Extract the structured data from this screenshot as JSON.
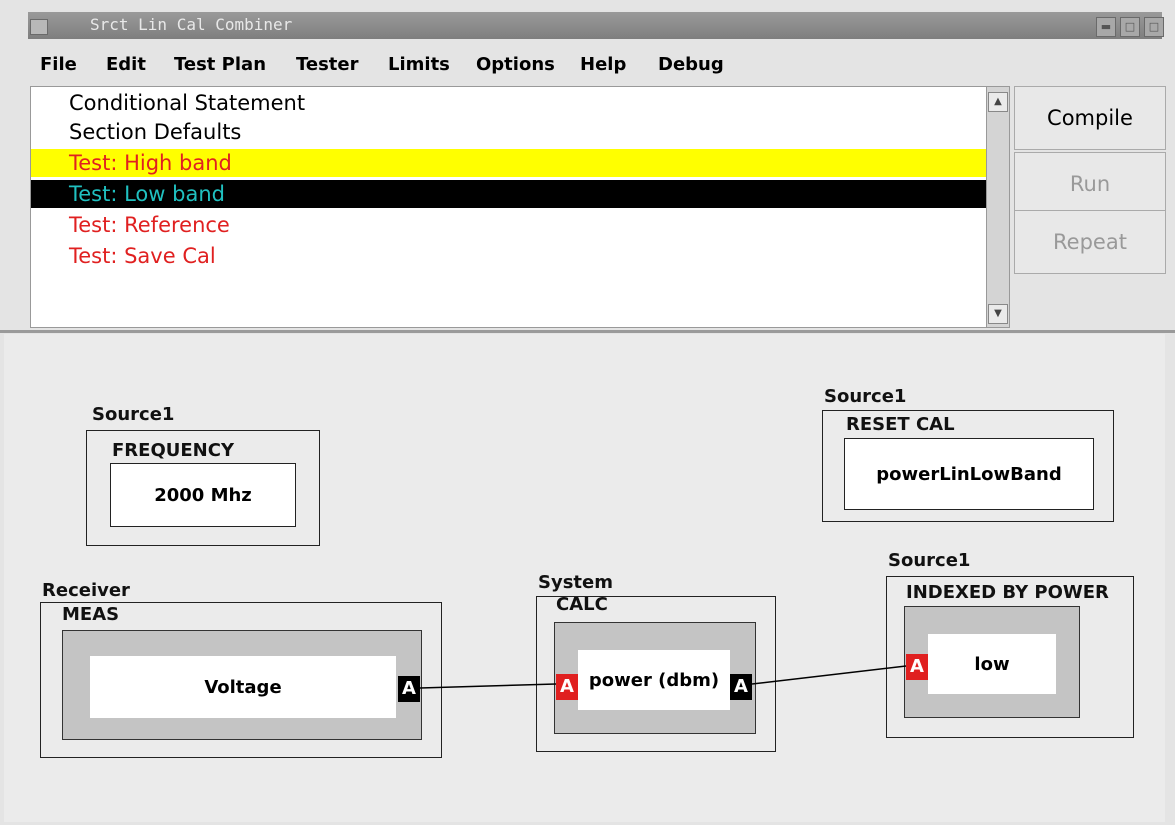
{
  "window": {
    "title": "Srct Lin Cal Combiner"
  },
  "menu": [
    "File",
    "Edit",
    "Test Plan",
    "Tester",
    "Limits",
    "Options",
    "Help",
    "Debug"
  ],
  "list": {
    "items": [
      {
        "label": "Conditional Statement",
        "color": "#000000",
        "bg": "",
        "state": "normal"
      },
      {
        "label": "Section Defaults",
        "color": "#000000",
        "bg": "",
        "state": "normal"
      },
      {
        "label": "Test: High band",
        "color": "#e02020",
        "bg": "#ffff00",
        "state": "highlighted"
      },
      {
        "label": "Test: Low band",
        "color": "#20c0c0",
        "bg": "#000000",
        "state": "selected"
      },
      {
        "label": "Test: Reference",
        "color": "#e02020",
        "bg": "",
        "state": "normal"
      },
      {
        "label": "Test: Save Cal",
        "color": "#e02020",
        "bg": "",
        "state": "normal"
      }
    ]
  },
  "buttons": {
    "compile": "Compile",
    "run": "Run",
    "repeat": "Repeat"
  },
  "diagram": {
    "freq": {
      "source": "Source1",
      "name": "FREQUENCY",
      "value": "2000 Mhz"
    },
    "reset": {
      "source": "Source1",
      "name": "RESET CAL",
      "value": "powerLinLowBand"
    },
    "meas": {
      "source": "Receiver",
      "name": "MEAS",
      "value": "Voltage",
      "port": "A"
    },
    "calc": {
      "source": "System",
      "name": "CALC",
      "value": "power (dbm)",
      "in_port": "A",
      "out_port": "A"
    },
    "indexed": {
      "source": "Source1",
      "name": "INDEXED BY POWER",
      "value": "low",
      "port": "A"
    }
  },
  "colors": {
    "accent_red": "#e02020",
    "highlight": "#ffff00",
    "selection": "#000000"
  }
}
